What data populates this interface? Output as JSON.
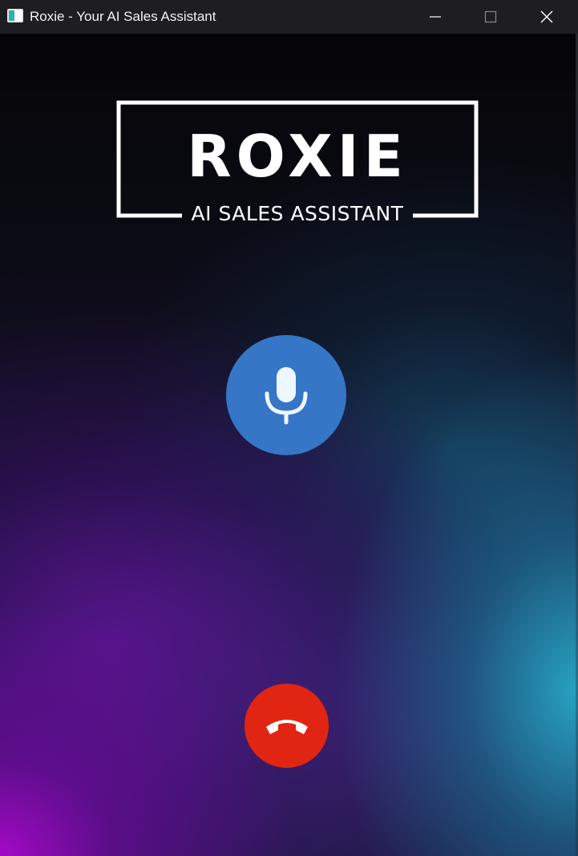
{
  "window": {
    "title": "Roxie - Your AI Sales Assistant",
    "icon": "app-window-icon",
    "controls": {
      "minimize_icon": "minimize-icon",
      "maximize_icon": "maximize-icon",
      "close_icon": "close-icon"
    }
  },
  "logo": {
    "name": "ROXIE",
    "tagline": "AI SALES ASSISTANT"
  },
  "call": {
    "mic_icon": "microphone-icon",
    "hangup_icon": "phone-hangup-icon"
  },
  "colors": {
    "titlebar": "#1e1e22",
    "mic_button": "#3576c6",
    "hangup_button": "#e02612",
    "logo": "#ffffff"
  }
}
